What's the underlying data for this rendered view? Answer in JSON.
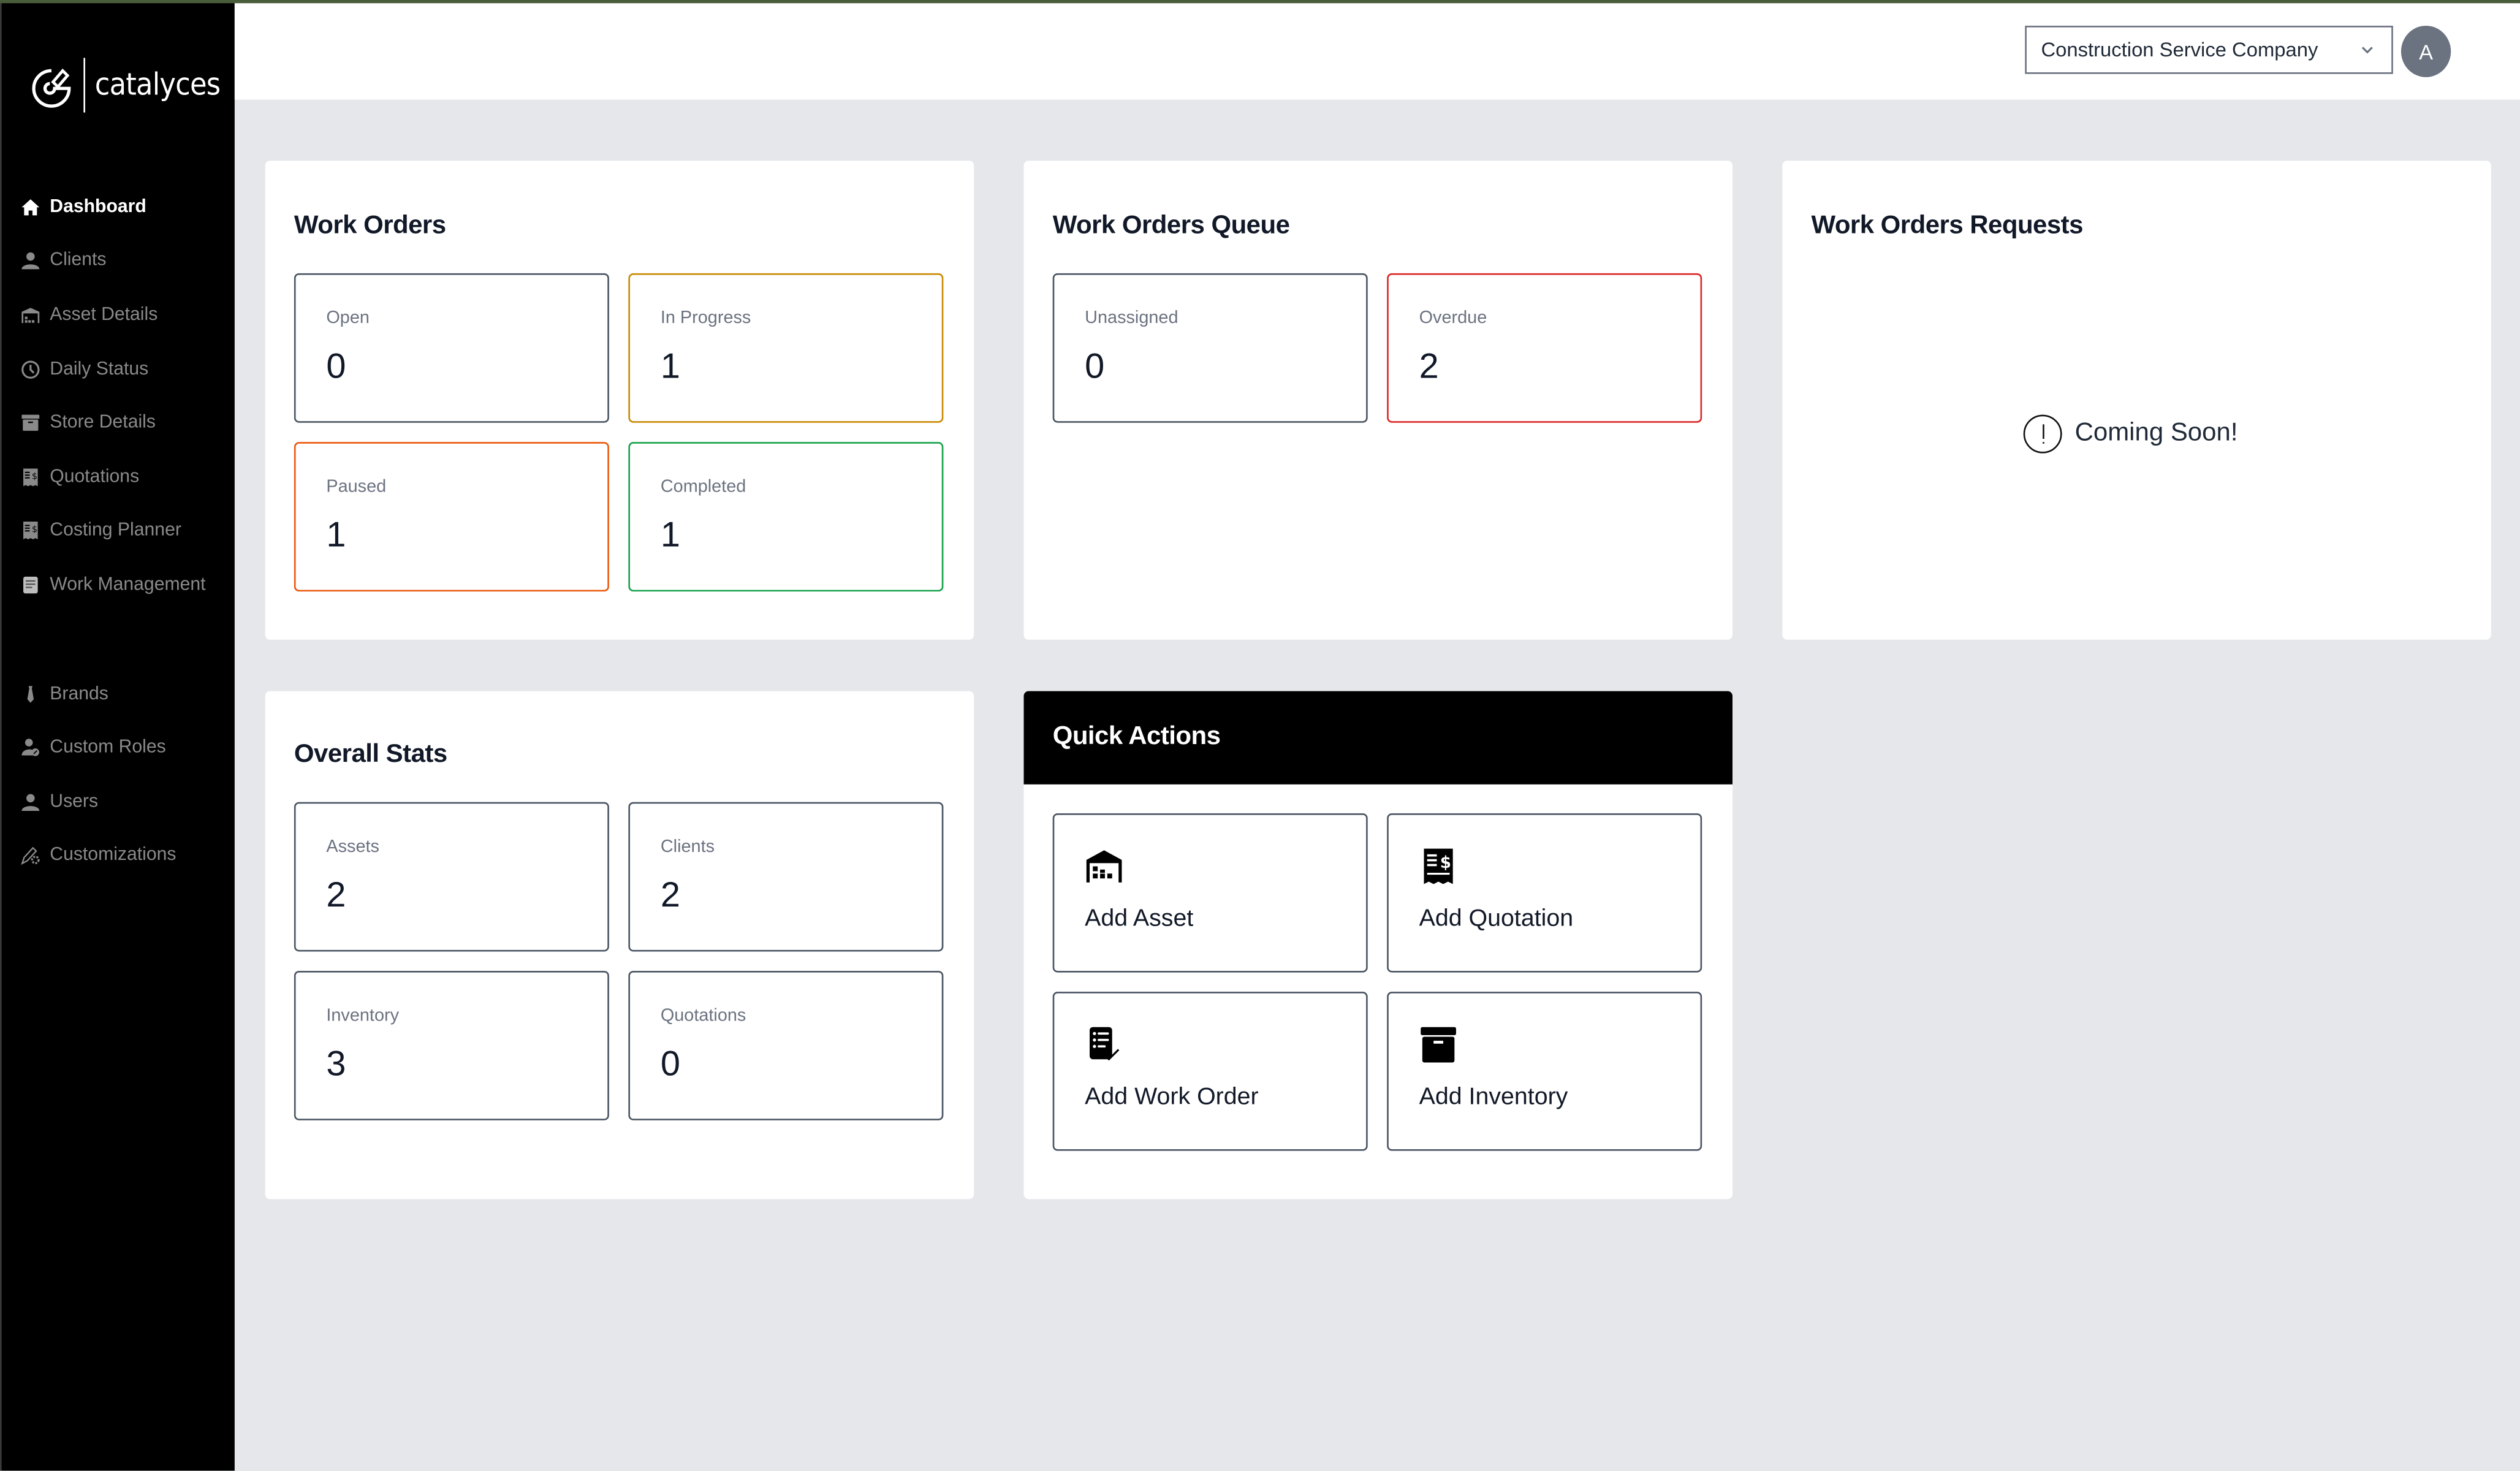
{
  "brand": {
    "name": "catalyces",
    "accent": "#000000"
  },
  "sidebar": {
    "items": [
      {
        "label": "Dashboard",
        "icon": "home-icon",
        "active": true
      },
      {
        "label": "Clients",
        "icon": "user-icon"
      },
      {
        "label": "Asset Details",
        "icon": "warehouse-icon"
      },
      {
        "label": "Daily Status",
        "icon": "clock-icon"
      },
      {
        "label": "Store Details",
        "icon": "archive-box-icon"
      },
      {
        "label": "Quotations",
        "icon": "receipt-dollar-icon"
      },
      {
        "label": "Costing Planner",
        "icon": "receipt-dollar-icon"
      },
      {
        "label": "Work Management",
        "icon": "clipboard-list-icon"
      }
    ],
    "secondary_items": [
      {
        "label": "Brands",
        "icon": "tie-icon"
      },
      {
        "label": "Custom Roles",
        "icon": "user-gear-icon"
      },
      {
        "label": "Users",
        "icon": "user-icon"
      },
      {
        "label": "Customizations",
        "icon": "pen-gear-icon"
      }
    ]
  },
  "header": {
    "company_select": {
      "value": "Construction Service Company"
    },
    "avatar_initial": "A"
  },
  "work_orders": {
    "title": "Work Orders",
    "stats": [
      {
        "label": "Open",
        "value": "0",
        "color": "#4b5563"
      },
      {
        "label": "In Progress",
        "value": "1",
        "color": "#ca8a04"
      },
      {
        "label": "Paused",
        "value": "1",
        "color": "#ea580c"
      },
      {
        "label": "Completed",
        "value": "1",
        "color": "#16a34a"
      }
    ]
  },
  "queue": {
    "title": "Work Orders Queue",
    "stats": [
      {
        "label": "Unassigned",
        "value": "0",
        "color": "#4b5563"
      },
      {
        "label": "Overdue",
        "value": "2",
        "color": "#dc2626"
      }
    ]
  },
  "requests": {
    "title": "Work Orders Requests",
    "message": "Coming Soon!"
  },
  "overall": {
    "title": "Overall Stats",
    "stats": [
      {
        "label": "Assets",
        "value": "2"
      },
      {
        "label": "Clients",
        "value": "2"
      },
      {
        "label": "Inventory",
        "value": "3"
      },
      {
        "label": "Quotations",
        "value": "0"
      }
    ]
  },
  "quick_actions": {
    "title": "Quick Actions",
    "actions": [
      {
        "label": "Add Asset",
        "icon": "warehouse-icon"
      },
      {
        "label": "Add Quotation",
        "icon": "receipt-dollar-icon"
      },
      {
        "label": "Add Work Order",
        "icon": "clipboard-check-icon"
      },
      {
        "label": "Add Inventory",
        "icon": "archive-box-icon"
      }
    ]
  }
}
